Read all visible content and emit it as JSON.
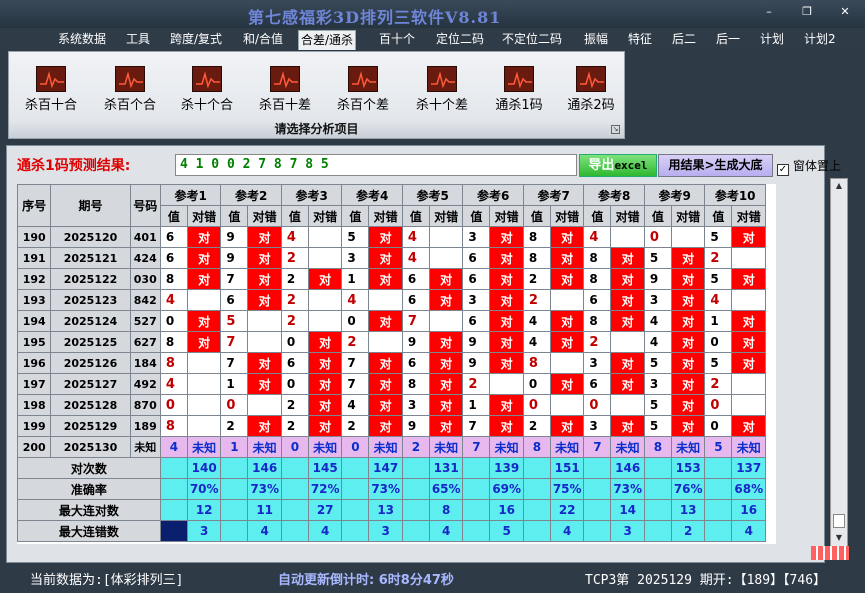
{
  "window": {
    "title": "第七感福彩3D排列三软件V8.81",
    "min": "–",
    "restore": "❐",
    "close": "✕"
  },
  "menu": [
    "系统数据",
    "工具",
    "跨度/复式",
    "和/合值",
    "合差/通杀",
    "百十个",
    "定位二码",
    "不定位二码",
    "振幅",
    "特征",
    "后二",
    "后一",
    "计划",
    "计划2"
  ],
  "menu_active": "合差/通杀",
  "ribbon": {
    "buttons": [
      "杀百十合",
      "杀百个合",
      "杀十个合",
      "杀百十差",
      "杀百个差",
      "杀十个差",
      "通杀1码",
      "通杀2码"
    ],
    "caption": "请选择分析项目"
  },
  "prediction": {
    "label": "通杀1码预测结果:",
    "value": "4 1 0 0 2 7 8 7 8 5"
  },
  "buttons": {
    "export": "导出",
    "export_lat": "excel",
    "generate": "用结果>生成大底"
  },
  "checkbox": {
    "label": "窗体置上",
    "checked": true,
    "mark": "✓"
  },
  "grid": {
    "header": {
      "seq": "序号",
      "period": "期号",
      "code": "号码",
      "refs": [
        "参考1",
        "参考2",
        "参考3",
        "参考4",
        "参考5",
        "参考6",
        "参考7",
        "参考8",
        "参考9",
        "参考10"
      ],
      "val": "值",
      "right_wrong": "对错"
    },
    "rows": [
      {
        "seq": "190",
        "period": "2025120",
        "code": "401",
        "cells": [
          [
            "6",
            1
          ],
          [
            "9",
            1
          ],
          [
            "4",
            0
          ],
          [
            "5",
            1
          ],
          [
            "4",
            0
          ],
          [
            "3",
            1
          ],
          [
            "8",
            1
          ],
          [
            "4",
            0
          ],
          [
            "0",
            0
          ],
          [
            "5",
            1
          ]
        ]
      },
      {
        "seq": "191",
        "period": "2025121",
        "code": "424",
        "cells": [
          [
            "6",
            1
          ],
          [
            "9",
            1
          ],
          [
            "2",
            0
          ],
          [
            "3",
            1
          ],
          [
            "4",
            0
          ],
          [
            "6",
            1
          ],
          [
            "8",
            1
          ],
          [
            "8",
            1
          ],
          [
            "5",
            1
          ],
          [
            "2",
            0
          ]
        ]
      },
      {
        "seq": "192",
        "period": "2025122",
        "code": "030",
        "cells": [
          [
            "8",
            1
          ],
          [
            "7",
            1
          ],
          [
            "2",
            1
          ],
          [
            "1",
            1
          ],
          [
            "6",
            1
          ],
          [
            "6",
            1
          ],
          [
            "2",
            1
          ],
          [
            "8",
            1
          ],
          [
            "9",
            1
          ],
          [
            "5",
            1
          ]
        ]
      },
      {
        "seq": "193",
        "period": "2025123",
        "code": "842",
        "cells": [
          [
            "4",
            0
          ],
          [
            "6",
            1
          ],
          [
            "2",
            0
          ],
          [
            "4",
            0
          ],
          [
            "6",
            1
          ],
          [
            "3",
            1
          ],
          [
            "2",
            0
          ],
          [
            "6",
            1
          ],
          [
            "3",
            1
          ],
          [
            "4",
            0
          ]
        ]
      },
      {
        "seq": "194",
        "period": "2025124",
        "code": "527",
        "cells": [
          [
            "0",
            1
          ],
          [
            "5",
            0
          ],
          [
            "2",
            0
          ],
          [
            "0",
            1
          ],
          [
            "7",
            0
          ],
          [
            "6",
            1
          ],
          [
            "4",
            1
          ],
          [
            "8",
            1
          ],
          [
            "4",
            1
          ],
          [
            "1",
            1
          ]
        ]
      },
      {
        "seq": "195",
        "period": "2025125",
        "code": "627",
        "cells": [
          [
            "8",
            1
          ],
          [
            "7",
            0
          ],
          [
            "0",
            1
          ],
          [
            "2",
            0
          ],
          [
            "9",
            1
          ],
          [
            "9",
            1
          ],
          [
            "4",
            1
          ],
          [
            "2",
            0
          ],
          [
            "4",
            1
          ],
          [
            "0",
            1
          ]
        ]
      },
      {
        "seq": "196",
        "period": "2025126",
        "code": "184",
        "cells": [
          [
            "8",
            0
          ],
          [
            "7",
            1
          ],
          [
            "6",
            1
          ],
          [
            "7",
            1
          ],
          [
            "6",
            1
          ],
          [
            "9",
            1
          ],
          [
            "8",
            0
          ],
          [
            "3",
            1
          ],
          [
            "5",
            1
          ],
          [
            "5",
            1
          ]
        ]
      },
      {
        "seq": "197",
        "period": "2025127",
        "code": "492",
        "cells": [
          [
            "4",
            0
          ],
          [
            "1",
            1
          ],
          [
            "0",
            1
          ],
          [
            "7",
            1
          ],
          [
            "8",
            1
          ],
          [
            "2",
            0
          ],
          [
            "0",
            1
          ],
          [
            "6",
            1
          ],
          [
            "3",
            1
          ],
          [
            "2",
            0
          ]
        ]
      },
      {
        "seq": "198",
        "period": "2025128",
        "code": "870",
        "cells": [
          [
            "0",
            0
          ],
          [
            "0",
            0
          ],
          [
            "2",
            1
          ],
          [
            "4",
            1
          ],
          [
            "3",
            1
          ],
          [
            "1",
            1
          ],
          [
            "0",
            0
          ],
          [
            "0",
            0
          ],
          [
            "5",
            1
          ],
          [
            "0",
            0
          ]
        ]
      },
      {
        "seq": "199",
        "period": "2025129",
        "code": "189",
        "cells": [
          [
            "8",
            0
          ],
          [
            "2",
            1
          ],
          [
            "2",
            1
          ],
          [
            "2",
            1
          ],
          [
            "9",
            1
          ],
          [
            "7",
            1
          ],
          [
            "2",
            1
          ],
          [
            "3",
            1
          ],
          [
            "5",
            1
          ],
          [
            "0",
            1
          ]
        ]
      }
    ],
    "hit_text": "对",
    "future": {
      "seq": "200",
      "period": "2025130",
      "code": "未知",
      "values": [
        "4",
        "1",
        "0",
        "0",
        "2",
        "7",
        "8",
        "7",
        "8",
        "5"
      ],
      "status": "未知"
    },
    "stats": [
      {
        "label": "对次数",
        "values": [
          "140",
          "146",
          "145",
          "147",
          "131",
          "139",
          "151",
          "146",
          "153",
          "137"
        ]
      },
      {
        "label": "准确率",
        "values": [
          "70%",
          "73%",
          "72%",
          "73%",
          "65%",
          "69%",
          "75%",
          "73%",
          "76%",
          "68%"
        ]
      },
      {
        "label": "最大连对数",
        "values": [
          "12",
          "11",
          "27",
          "13",
          "8",
          "16",
          "22",
          "14",
          "13",
          "16"
        ]
      },
      {
        "label": "最大连错数",
        "values": [
          "3",
          "4",
          "4",
          "3",
          "4",
          "5",
          "4",
          "3",
          "2",
          "4"
        ]
      }
    ]
  },
  "status": {
    "data_source": "当前数据为:[体彩排列三]",
    "timer": "自动更新倒计时: 6时8分47秒",
    "draw": "TCP3第 2025129 期开:【189】【746】"
  }
}
